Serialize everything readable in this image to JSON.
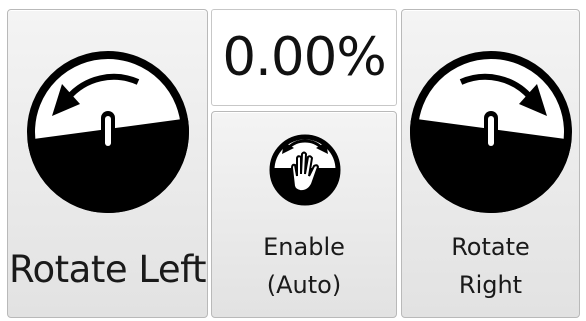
{
  "rotate_left": {
    "label": "Rotate Left",
    "icon": "rotate-left-gauge-icon"
  },
  "rotate_right": {
    "label_line1": "Rotate",
    "label_line2": "Right",
    "icon": "rotate-right-gauge-icon"
  },
  "readout": {
    "value": "0.00%"
  },
  "enable": {
    "label_line1": "Enable",
    "label_line2": "(Auto)",
    "icon": "hand-rotate-icon"
  },
  "colors": {
    "panel_light": "#f4f4f4",
    "panel_dark": "#e2e2e2",
    "gauge_fill": "#000000",
    "gauge_face": "#ffffff"
  }
}
